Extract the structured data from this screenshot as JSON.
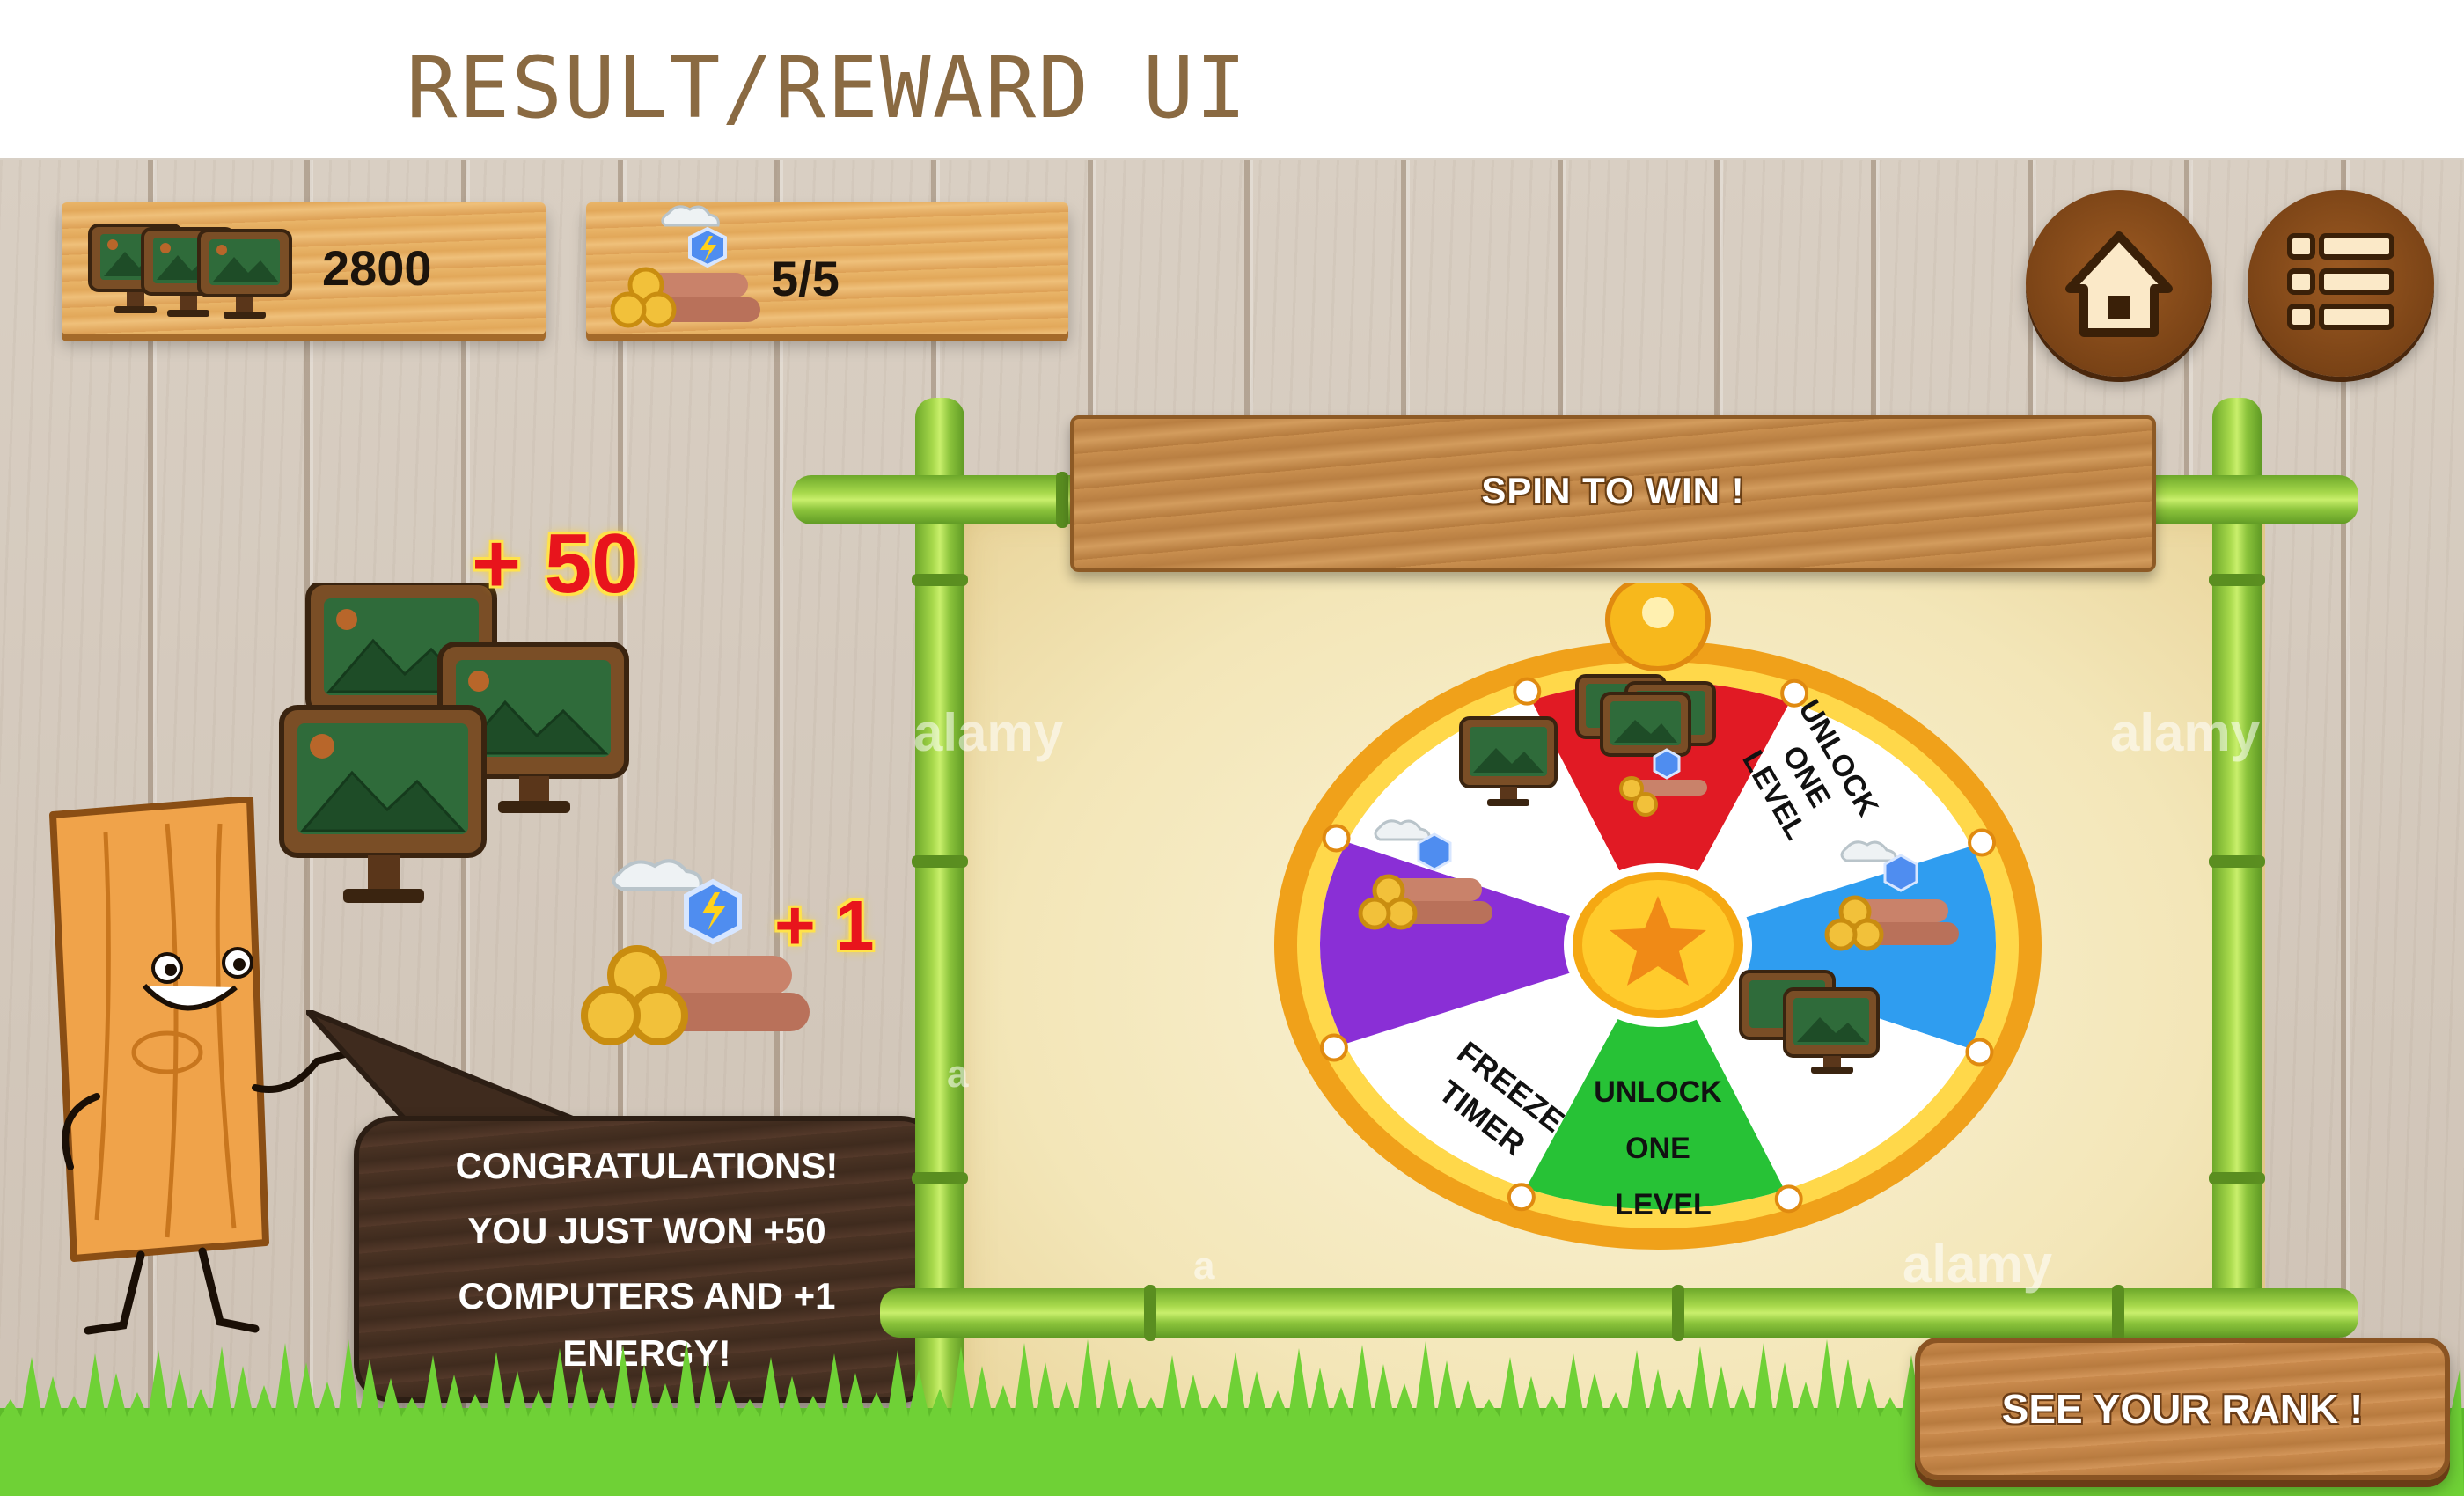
{
  "page": {
    "title": "RESULT/REWARD UI",
    "title_color": "#8a6a42"
  },
  "hud": {
    "computers": {
      "icon": "computer-icon",
      "count": "2800"
    },
    "energy": {
      "icon": "energy-logs-icon",
      "value": "5/5"
    },
    "home_button": {
      "icon": "home-icon"
    },
    "menu_button": {
      "icon": "menu-list-icon"
    }
  },
  "rewards": {
    "computers_gain": "+ 50",
    "energy_gain": "+ 1"
  },
  "message": {
    "lines": [
      "CONGRATULATIONS!",
      "YOU JUST WON +50",
      "COMPUTERS AND +1",
      "ENERGY!"
    ]
  },
  "wheel": {
    "banner_title": "SPIN TO WIN !",
    "segments": [
      {
        "color": "#e11a24",
        "prize": "computer-icon"
      },
      {
        "color": "#ffffff",
        "prize": "computers-and-energy-icon"
      },
      {
        "color": "#2f9df0",
        "label_lines": [
          "UNLOCK",
          "ONE",
          "LEVEL"
        ]
      },
      {
        "color": "#ffffff",
        "prize": "energy-logs-icon"
      },
      {
        "color": "#27c236",
        "prize": "computers-icon"
      },
      {
        "color": "#ffffff",
        "label_lines": [
          "UNLOCK",
          "ONE",
          "LEVEL"
        ]
      },
      {
        "color": "#8a2fd6",
        "label_lines": [
          "FREEZE",
          "TIMER"
        ]
      },
      {
        "color": "#ffffff",
        "prize": "energy-logs-icon"
      }
    ],
    "center_icon": "star-icon",
    "pointer_icon": "pointer-pin-icon"
  },
  "rank_button": {
    "label": "SEE YOUR RANK !"
  },
  "watermarks": [
    "alamy",
    "alamy",
    "a",
    "a",
    "alamy"
  ],
  "colors": {
    "accent_red": "#e8141c",
    "accent_yellow": "#ffd21a",
    "bamboo_green": "#8cc43c",
    "wood": "#c98f4f"
  }
}
